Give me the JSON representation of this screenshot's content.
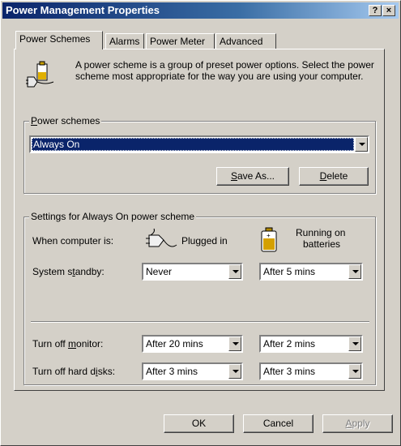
{
  "window": {
    "title": "Power Management Properties",
    "help_button": "?",
    "close_button": "×"
  },
  "tabs": [
    {
      "label": "Power Schemes"
    },
    {
      "label": "Alarms"
    },
    {
      "label": "Power Meter"
    },
    {
      "label": "Advanced"
    }
  ],
  "intro": {
    "text": "A power scheme is a group of preset power options. Select the power scheme most appropriate for the way you are using your computer."
  },
  "schemes": {
    "group_label": "Power schemes",
    "selected": "Always On",
    "save_as_label": "Save As...",
    "delete_label": "Delete"
  },
  "settings": {
    "group_label": "Settings for Always On power scheme",
    "when_label": "When computer is:",
    "plugged_label": "Plugged in",
    "batteries_label_1": "Running on",
    "batteries_label_2": "batteries",
    "standby_label": "System standby:",
    "standby_plugged": "Never",
    "standby_battery": "After 5 mins",
    "monitor_label": "Turn off monitor:",
    "monitor_plugged": "After 20 mins",
    "monitor_battery": "After 2 mins",
    "disks_label": "Turn off hard disks:",
    "disks_plugged": "After 3 mins",
    "disks_battery": "After 3 mins"
  },
  "footer": {
    "ok": "OK",
    "cancel": "Cancel",
    "apply": "Apply"
  },
  "colors": {
    "titlebar": "#0a246a",
    "selection": "#0a246a",
    "face": "#d4d0c8"
  }
}
